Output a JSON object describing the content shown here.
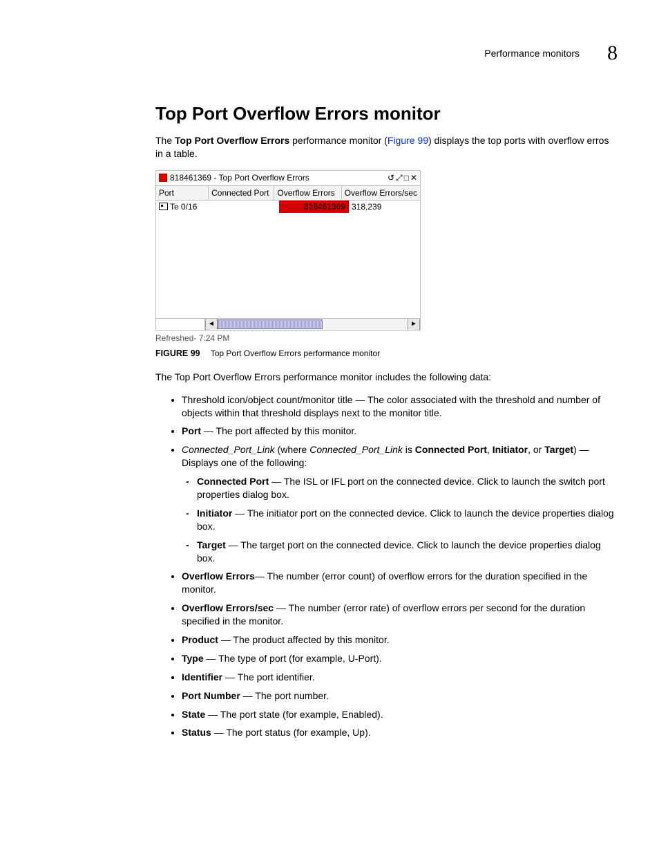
{
  "header": {
    "section": "Performance monitors",
    "chapter": "8"
  },
  "title": "Top Port Overflow Errors monitor",
  "intro": {
    "pre": "The ",
    "bold1": "Top Port Overflow Errors",
    "mid": " performance monitor (",
    "link": "Figure 99",
    "post": ") displays the top ports with overflow erros in a table."
  },
  "figure": {
    "titlebar": "818461369 - Top Port Overflow Errors",
    "columns": {
      "port": "Port",
      "connected": "Connected Port",
      "overflow": "Overflow Errors",
      "overflow_sec": "Overflow Errors/sec"
    },
    "row": {
      "port": "Te 0/16",
      "connected": "",
      "overflow": "818461369",
      "overflow_sec": "318,239"
    },
    "refreshed": "Refreshed- 7:24 PM",
    "caption_label": "FIGURE 99",
    "caption_text": "Top Port Overflow Errors performance monitor"
  },
  "lead": "The Top Port Overflow Errors performance monitor includes the following data:",
  "bullets": {
    "b1": "Threshold icon/object count/monitor title — The color associated with the threshold and number of objects within that threshold displays next to the monitor title.",
    "b2_label": "Port",
    "b2_rest": " — The port affected by this monitor.",
    "b3_i1": "Connected_Port_Link",
    "b3_mid1": " (where ",
    "b3_i2": "Connected_Port_Link",
    "b3_mid2": " is ",
    "b3_b1": "Connected Port",
    "b3_sep1": ", ",
    "b3_b2": "Initiator",
    "b3_sep2": ", or ",
    "b3_b3": "Target",
    "b3_end": ") — Displays one of the following:",
    "b3_s1_label": "Connected Port",
    "b3_s1_rest": " — The ISL or IFL port on the connected device. Click to launch the switch port properties dialog box.",
    "b3_s2_label": "Initiator",
    "b3_s2_rest": " — The initiator port on the connected device. Click to launch the device properties dialog box.",
    "b3_s3_label": "Target",
    "b3_s3_rest": " — The target port on the connected device. Click to launch the device properties dialog box.",
    "b4_label": "Overflow Errors",
    "b4_rest": "— The number (error count) of overflow errors for the duration specified in the monitor.",
    "b5_label": "Overflow Errors/sec",
    "b5_rest": " — The number (error rate) of overflow errors per second for the duration specified in the monitor.",
    "b6_label": "Product",
    "b6_rest": " — The product affected by this monitor.",
    "b7_label": "Type",
    "b7_rest": " — The type of port (for example, U-Port).",
    "b8_label": "Identifier",
    "b8_rest": " — The port identifier.",
    "b9_label": "Port Number",
    "b9_rest": " — The port number.",
    "b10_label": "State",
    "b10_rest": " — The port state (for example, Enabled).",
    "b11_label": "Status",
    "b11_rest": " — The port status (for example, Up)."
  }
}
